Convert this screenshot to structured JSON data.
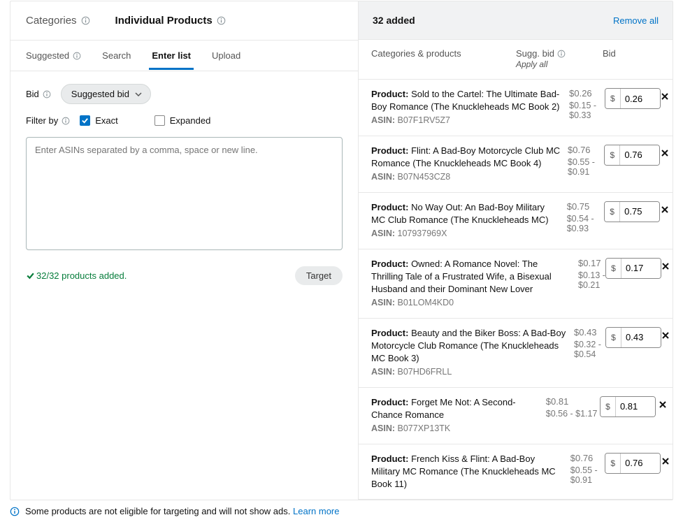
{
  "top_tabs": {
    "categories": "Categories",
    "individual": "Individual Products"
  },
  "sub_tabs": {
    "suggested": "Suggested",
    "search": "Search",
    "enter_list": "Enter list",
    "upload": "Upload"
  },
  "controls": {
    "bid_label": "Bid",
    "bid_value": "Suggested bid",
    "filter_label": "Filter by",
    "exact_label": "Exact",
    "expanded_label": "Expanded",
    "textarea_placeholder": "Enter ASINs separated by a comma, space or new line.",
    "status_text": "32/32 products added.",
    "target_button": "Target"
  },
  "right": {
    "count_label": "32 added",
    "remove_all": "Remove all",
    "columns": {
      "name": "Categories & products",
      "sugg": "Sugg. bid",
      "apply_all": "Apply all",
      "bid": "Bid"
    }
  },
  "currency_symbol": "$",
  "products": [
    {
      "title": "Sold to the Cartel: The Ultimate Bad-Boy Romance (The Knuckleheads MC Book 2)",
      "asin": "B07F1RV5Z7",
      "sugg": "$0.26",
      "range": "$0.15 - $0.33",
      "bid": "0.26"
    },
    {
      "title": "Flint: A Bad-Boy Motorcycle Club MC Romance (The Knuckleheads MC Book 4)",
      "asin": "B07N453CZ8",
      "sugg": "$0.76",
      "range": "$0.55 - $0.91",
      "bid": "0.76"
    },
    {
      "title": "No Way Out: An Bad-Boy Military MC Club Romance (The Knuckleheads MC)",
      "asin": "107937969X",
      "sugg": "$0.75",
      "range": "$0.54 - $0.93",
      "bid": "0.75"
    },
    {
      "title": "Owned: A Romance Novel: The Thrilling Tale of a Frustrated Wife, a Bisexual Husband and their Dominant New Lover",
      "asin": "B01LOM4KD0",
      "sugg": "$0.17",
      "range": "$0.13 - $0.21",
      "bid": "0.17"
    },
    {
      "title": "Beauty and the Biker Boss: A Bad-Boy Motorcycle Club Romance (The Knuckleheads MC Book 3)",
      "asin": "B07HD6FRLL",
      "sugg": "$0.43",
      "range": "$0.32 - $0.54",
      "bid": "0.43"
    },
    {
      "title": "Forget Me Not: A Second-Chance Romance",
      "asin": "B077XP13TK",
      "sugg": "$0.81",
      "range": "$0.56 - $1.17",
      "bid": "0.81"
    },
    {
      "title": "French Kiss & Flint: A Bad-Boy Military MC Romance (The Knuckleheads MC Book 11)",
      "asin": "",
      "sugg": "$0.76",
      "range": "$0.55 - $0.91",
      "bid": "0.76"
    }
  ],
  "footer": {
    "text": "Some products are not eligible for targeting and will not show ads.",
    "link": "Learn more"
  }
}
